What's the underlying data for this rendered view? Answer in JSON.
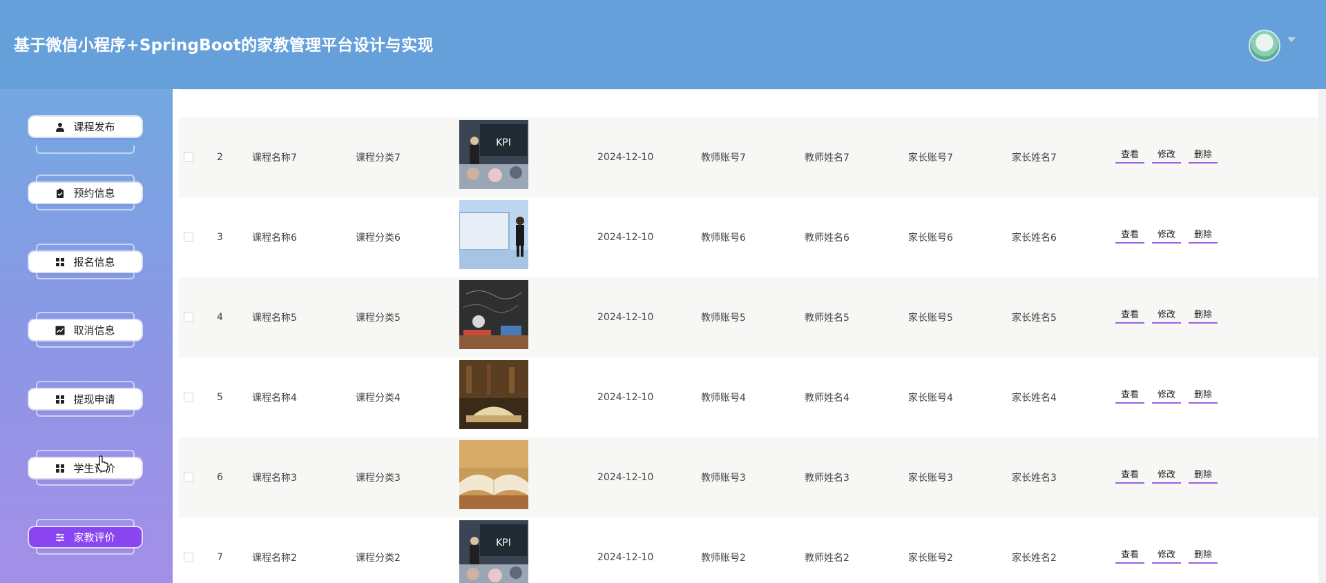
{
  "header": {
    "title": "基于微信小程序+SpringBoot的家教管理平台设计与实现"
  },
  "sidebar": {
    "items": [
      {
        "label": "课程发布",
        "icon": "user-icon",
        "active": false
      },
      {
        "label": "预约信息",
        "icon": "clipboard-check-icon",
        "active": false
      },
      {
        "label": "报名信息",
        "icon": "grid-icon",
        "active": false
      },
      {
        "label": "取消信息",
        "icon": "chart-line-icon",
        "active": false
      },
      {
        "label": "提现申请",
        "icon": "grid-icon",
        "active": false
      },
      {
        "label": "学生评价",
        "icon": "grid-icon",
        "active": false
      },
      {
        "label": "家教评价",
        "icon": "sliders-icon",
        "active": true
      }
    ]
  },
  "table": {
    "actions": {
      "view": "查看",
      "edit": "修改",
      "delete": "删除"
    },
    "rows": [
      {
        "index": "2",
        "course_name": "课程名称7",
        "category": "课程分类7",
        "image": "kpi-classroom",
        "date": "2024-12-10",
        "teacher_account": "教师账号7",
        "teacher_name": "教师姓名7",
        "parent_account": "家长账号7",
        "parent_name": "家长姓名7"
      },
      {
        "index": "3",
        "course_name": "课程名称6",
        "category": "课程分类6",
        "image": "presenter-screen",
        "date": "2024-12-10",
        "teacher_account": "教师账号6",
        "teacher_name": "教师姓名6",
        "parent_account": "家长账号6",
        "parent_name": "家长姓名6"
      },
      {
        "index": "4",
        "course_name": "课程名称5",
        "category": "课程分类5",
        "image": "chalkboard-clock",
        "date": "2024-12-10",
        "teacher_account": "教师账号5",
        "teacher_name": "教师姓名5",
        "parent_account": "家长账号5",
        "parent_name": "家长姓名5"
      },
      {
        "index": "5",
        "course_name": "课程名称4",
        "category": "课程分类4",
        "image": "library-books",
        "date": "2024-12-10",
        "teacher_account": "教师账号4",
        "teacher_name": "教师姓名4",
        "parent_account": "家长账号4",
        "parent_name": "家长姓名4"
      },
      {
        "index": "6",
        "course_name": "课程名称3",
        "category": "课程分类3",
        "image": "open-book",
        "date": "2024-12-10",
        "teacher_account": "教师账号3",
        "teacher_name": "教师姓名3",
        "parent_account": "家长账号3",
        "parent_name": "家长姓名3"
      },
      {
        "index": "7",
        "course_name": "课程名称2",
        "category": "课程分类2",
        "image": "kpi-classroom",
        "date": "2024-12-10",
        "teacher_account": "教师账号2",
        "teacher_name": "教师姓名2",
        "parent_account": "家长账号2",
        "parent_name": "家长姓名2"
      }
    ],
    "kpi_text": "KPI"
  },
  "colors": {
    "header_bg": "#65a0da",
    "active_menu": "#8a45f0",
    "button_underline": "#9a63e8"
  }
}
